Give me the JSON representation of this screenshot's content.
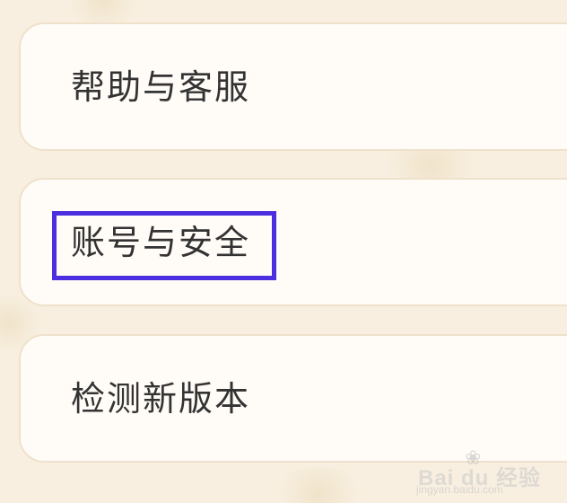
{
  "menu": {
    "items": [
      {
        "label": "帮助与客服"
      },
      {
        "label": "账号与安全"
      },
      {
        "label": "检测新版本"
      }
    ]
  },
  "watermark": {
    "brand": "Bai du 经验",
    "url": "jingyan.baidu.com"
  },
  "colors": {
    "background": "#f8efe0",
    "card": "#fffcf8",
    "card_border": "#efe1cb",
    "highlight": "#4a2ee0",
    "text": "#333333"
  }
}
